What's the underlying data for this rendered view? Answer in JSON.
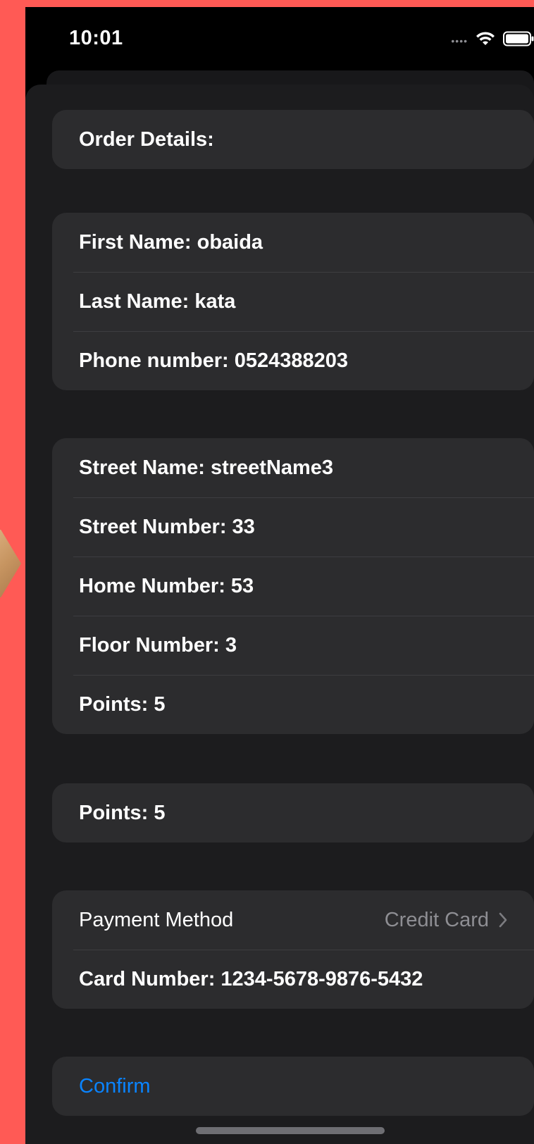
{
  "status_bar": {
    "time": "10:01"
  },
  "order_header": {
    "title": "Order Details:"
  },
  "customer": {
    "first_name": "First Name: obaida",
    "last_name": "Last Name: kata",
    "phone": "Phone number: 0524388203"
  },
  "address": {
    "street_name": "Street Name: streetName3",
    "street_number": "Street Number: 33",
    "home_number": "Home Number: 53",
    "floor_number": "Floor Number: 3",
    "points": "Points: 5"
  },
  "points_section": {
    "points": "Points: 5"
  },
  "payment": {
    "method_label": "Payment Method",
    "method_value": "Credit Card",
    "card_number": "Card Number: 1234-5678-9876-5432"
  },
  "actions": {
    "confirm_label": "Confirm"
  },
  "colors": {
    "background": "#ff5a55",
    "sheet": "#1c1c1e",
    "cell": "#2c2c2e",
    "accent": "#0a84ff",
    "secondary_text": "#8e8e93"
  },
  "icons": {
    "wifi": "wifi-icon",
    "battery": "battery-icon",
    "chevron": "chevron-right-icon"
  }
}
